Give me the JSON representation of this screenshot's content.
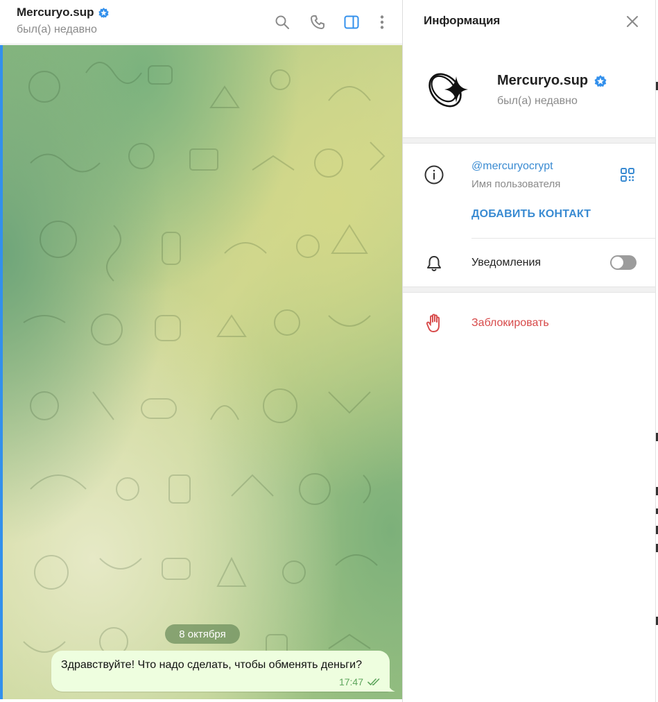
{
  "chat": {
    "title": "Mercuryo.sup",
    "status": "был(а) недавно",
    "date_separator": "8 октября",
    "messages": [
      {
        "text": "Здравствуйте! Что надо сделать, чтобы обменять деньги?",
        "time": "17:47",
        "read": true
      }
    ]
  },
  "header_actions": [
    {
      "name": "search-icon"
    },
    {
      "name": "phone-icon"
    },
    {
      "name": "sidebar-toggle-icon",
      "active": true
    },
    {
      "name": "more-vertical-icon"
    }
  ],
  "info_panel": {
    "title": "Информация",
    "profile": {
      "name": "Mercuryo.sup",
      "status": "был(а) недавно",
      "verified": true
    },
    "username": "@mercuryocrypt",
    "username_label": "Имя пользователя",
    "add_contact": "ДОБАВИТЬ КОНТАКТ",
    "notifications_label": "Уведомления",
    "notifications_enabled": false,
    "block_label": "Заблокировать"
  },
  "colors": {
    "accent": "#3390ec",
    "link": "#3a8bd2",
    "danger": "#d74949",
    "bubble_out": "#eefedf",
    "read_check": "#5ea55d"
  }
}
